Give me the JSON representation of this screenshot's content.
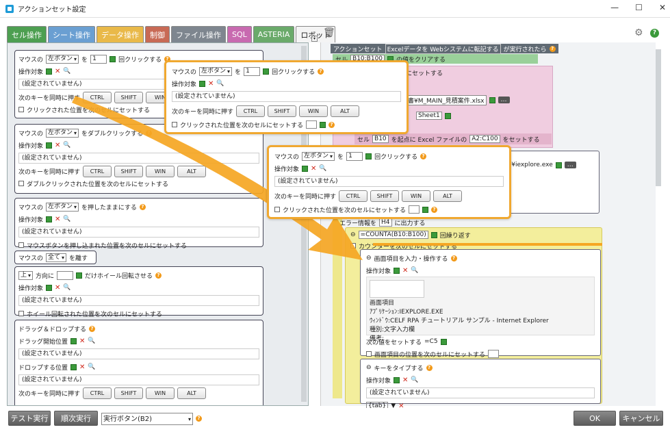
{
  "window": {
    "title": "アクションセット設定"
  },
  "tabs": [
    {
      "label": "セル操作",
      "color": "#4d9f51"
    },
    {
      "label": "シート操作",
      "color": "#6a9fd2"
    },
    {
      "label": "データ操作",
      "color": "#e9b949"
    },
    {
      "label": "制御",
      "color": "#c86a55"
    },
    {
      "label": "ファイル操作",
      "color": "#7e868f"
    },
    {
      "label": "SQL",
      "color": "#c86ab0"
    },
    {
      "label": "ASTERIA",
      "color": "#6aaa6a"
    },
    {
      "label": "ロボット",
      "color": "#f4f4f4"
    }
  ],
  "common": {
    "target_label": "操作対象",
    "unset": "(設定されていません)",
    "keys_label": "次のキーを同時に押す",
    "keys": [
      "CTRL",
      "SHIFT",
      "WIN",
      "ALT"
    ],
    "mouse_label": "マウスの",
    "left_btn": "左ボタン",
    "wo": "を",
    "one": "1",
    "click_suffix": "回クリックする",
    "click_next": "クリックされた位置を次のセルにセットする"
  },
  "cards": {
    "click": "回クリックする",
    "dbl_suffix": "をダブルクリックする",
    "dbl_next": "ダブルクリックされた位置を次のセルにセットする",
    "press_suffix": "を押したままにする",
    "press_next": "マウスボタンを押し込まれた位置を次のセルにセットする",
    "all": "全て",
    "release": "を離す",
    "up": "上",
    "dir": "方向に",
    "wheel": "だけホイール回転させる",
    "wheel_next": "ホイール回転された位置を次のセルにセットする",
    "dd_title": "ドラッグ＆ドロップする",
    "dd_start": "ドラッグ開始位置",
    "dd_drop": "ドロップする位置",
    "dd_next": "ドロップされた位置を次のセルにセットする"
  },
  "right": {
    "header": [
      "アクションセット",
      "Excelデータを Webシステムに転記する",
      "が実行されたら"
    ],
    "row1": [
      "セル",
      "B10:B100",
      "の値をクリアする"
    ],
    "row2": "にセットする",
    "file": "書¥M_MAIN_見積案件.xlsx",
    "sheet": "Sheet1",
    "row3": [
      "セル",
      "B10",
      "を起点に Excel ファイルの",
      "A2:C100",
      "をセットする"
    ],
    "ie": "er¥iexplore.exe",
    "err": [
      "エラー情報を",
      "H4",
      "に出力する"
    ],
    "loop": [
      "=COUNTA(B10:B100)",
      "回繰り返す"
    ],
    "counter": "カウンターを次のセルにセットする",
    "screen_title": "画面項目を入力・操作する",
    "screen_item": "画面項目",
    "app": "ｱﾌﾟﾘｹｰｼｮﾝ:IEXPLORE.EXE",
    "window": "ｳｨﾝﾄﾞｳ:CELF RPA チュートリアル サンプル - Internet Explorer",
    "kind": "種別:文字入力欄",
    "note": "備考:",
    "next_val": "次の値をセットする",
    "c5": "=C5",
    "screen_next": "画面項目の位置を次のセルにセットする",
    "type_title": "キーをタイプする",
    "tab": "{tab}"
  },
  "bottom": {
    "test": "テスト実行",
    "seq": "順次実行",
    "run_btn": "実行ボタン(B2)",
    "ok": "OK",
    "cancel": "キャンセル"
  }
}
